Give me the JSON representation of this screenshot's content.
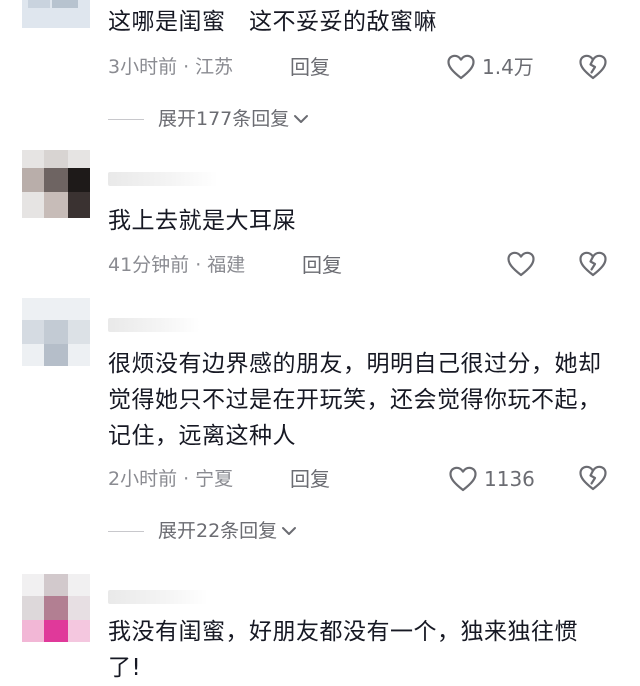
{
  "comments": [
    {
      "text": "这哪是闺蜜　这不妥妥的敌蜜嘛",
      "time": "3小时前",
      "location": "江苏",
      "reply_label": "回复",
      "likes": "1.4万",
      "expand_label": "展开177条回复"
    },
    {
      "text": "我上去就是大耳屎",
      "time": "41分钟前",
      "location": "福建",
      "reply_label": "回复",
      "likes": ""
    },
    {
      "text": "很烦没有边界感的朋友，明明自己很过分，她却觉得她只不过是在开玩笑，还会觉得你玩不起，记住，远离这种人",
      "time": "2小时前",
      "location": "宁夏",
      "reply_label": "回复",
      "likes": "1136",
      "expand_label": "展开22条回复"
    },
    {
      "text": "我没有闺蜜，好朋友都没有一个，独来独往惯了!"
    }
  ],
  "separator": "·",
  "icons": [
    "heart-outline-icon",
    "broken-heart-icon",
    "chevron-down-icon"
  ],
  "colors": {
    "text": "#161823",
    "meta": "#8a8b91",
    "icon": "#6b6c72"
  }
}
